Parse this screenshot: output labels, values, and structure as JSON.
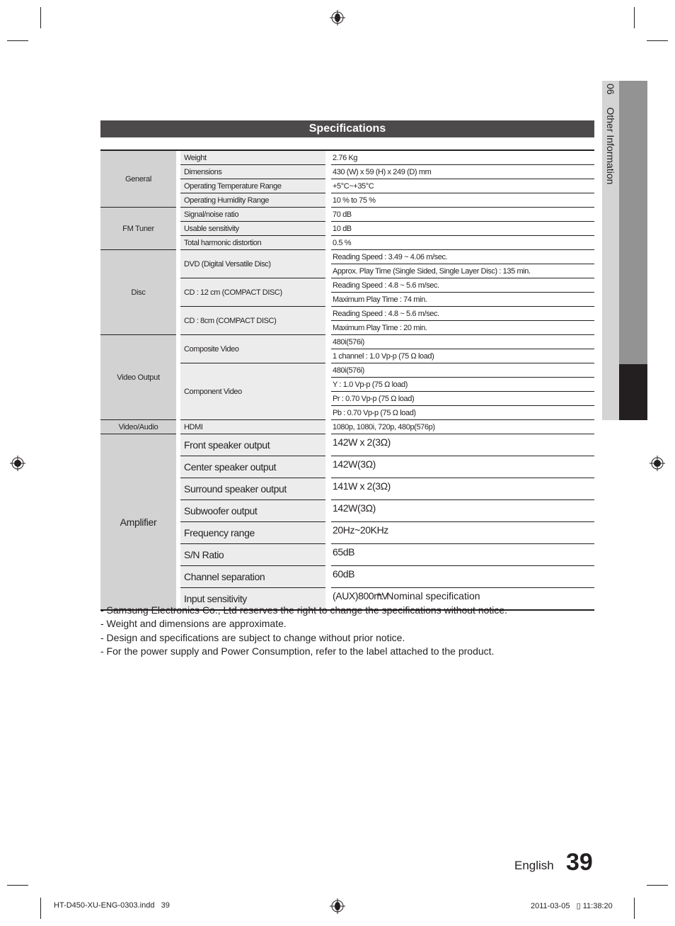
{
  "header": {
    "title": "Specifications"
  },
  "side_tab": {
    "number": "06",
    "label": "Other Information"
  },
  "spec_groups": [
    {
      "category": "General",
      "items": [
        {
          "name": "Weight",
          "values": [
            "2.76 Kg"
          ]
        },
        {
          "name": "Dimensions",
          "values": [
            "430 (W) x 59 (H) x 249 (D) mm"
          ]
        },
        {
          "name": "Operating Temperature Range",
          "values": [
            "+5°C~+35°C"
          ]
        },
        {
          "name": "Operating Humidity Range",
          "values": [
            "10 % to 75 %"
          ]
        }
      ]
    },
    {
      "category": "FM Tuner",
      "items": [
        {
          "name": "Signal/noise ratio",
          "values": [
            "70 dB"
          ]
        },
        {
          "name": "Usable sensitivity",
          "values": [
            "10 dB"
          ]
        },
        {
          "name": "Total harmonic distortion",
          "values": [
            "0.5 %"
          ]
        }
      ]
    },
    {
      "category": "Disc",
      "items": [
        {
          "name": "DVD (Digital Versatile Disc)",
          "values": [
            "Reading Speed : 3.49 ~ 4.06 m/sec.",
            "Approx. Play Time (Single Sided, Single Layer Disc) : 135 min."
          ]
        },
        {
          "name": "CD : 12 cm (COMPACT DISC)",
          "values": [
            "Reading Speed : 4.8 ~ 5.6 m/sec.",
            "Maximum Play Time : 74 min."
          ]
        },
        {
          "name": "CD : 8cm (COMPACT DISC)",
          "values": [
            "Reading Speed : 4.8 ~ 5.6 m/sec.",
            "Maximum Play Time : 20 min."
          ]
        }
      ]
    },
    {
      "category": "Video Output",
      "items": [
        {
          "name": "Composite Video",
          "values": [
            "480i(576i)",
            "1 channel : 1.0 Vp-p (75 Ω load)"
          ]
        },
        {
          "name": "Component Video",
          "values": [
            "480i(576i)",
            "Y : 1.0 Vp-p (75 Ω load)",
            "Pr : 0.70 Vp-p (75 Ω load)",
            "Pb : 0.70 Vp-p (75 Ω load)"
          ]
        }
      ]
    },
    {
      "category": "Video/Audio",
      "items": [
        {
          "name": "HDMI",
          "values": [
            "1080p, 1080i, 720p, 480p(576p)"
          ]
        }
      ]
    },
    {
      "category": "Amplifier",
      "large": true,
      "items": [
        {
          "name": "Front speaker output",
          "values": [
            "142W x 2(3Ω)"
          ]
        },
        {
          "name": "Center speaker output",
          "values": [
            "142W(3Ω)"
          ]
        },
        {
          "name": "Surround speaker output",
          "values": [
            "141W x 2(3Ω)"
          ]
        },
        {
          "name": "Subwoofer output",
          "values": [
            "142W(3Ω)"
          ]
        },
        {
          "name": "Frequency range",
          "values": [
            "20Hz~20KHz"
          ]
        },
        {
          "name": "S/N Ratio",
          "values": [
            "65dB"
          ]
        },
        {
          "name": "Channel separation",
          "values": [
            "60dB"
          ]
        },
        {
          "name": "Input sensitivity",
          "values": [
            "(AUX)800mV"
          ]
        }
      ]
    }
  ],
  "notes": {
    "nominal": "*: Nominal specification",
    "lines": [
      "- Samsung Electronics Co., Ltd reserves the right to change the specifications without notice.",
      "- Weight and dimensions are approximate.",
      "- Design and specifications are subject to change without prior notice.",
      "- For the power supply and Power Consumption, refer to the label attached to the product."
    ]
  },
  "footer": {
    "language": "English",
    "page_number": "39",
    "slug_file": "HT-D450-XU-ENG-0303.indd   39",
    "slug_date": "2011-03-05   ▯ 11:38:20"
  },
  "colors": {
    "title_bar": "#4d4a4b",
    "category_cell": "#d2d2d2",
    "item_cell": "#ececec",
    "side_tab_light": "#d4d4d4",
    "side_tab_mid": "#939393",
    "side_tab_dark": "#231f20"
  }
}
